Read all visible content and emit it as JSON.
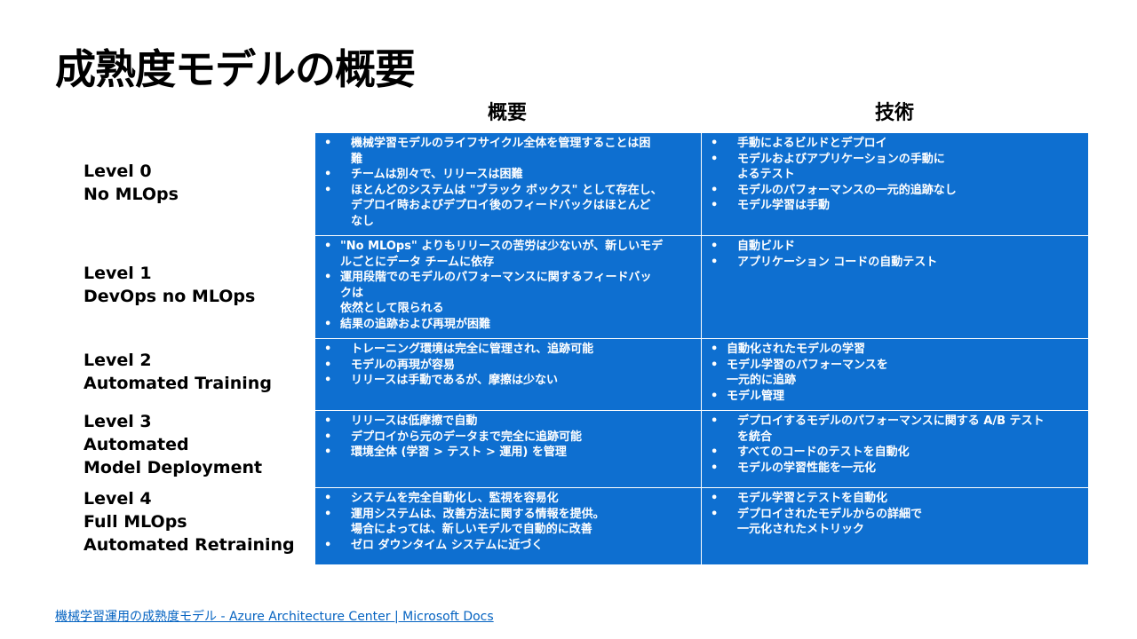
{
  "title": "成熟度モデルの概要",
  "columns": {
    "overview": "概要",
    "technology": "技術"
  },
  "rows": [
    {
      "level": [
        "Level 0",
        "No MLOps"
      ],
      "overview": [
        [
          "機械学習モデルのライフサイクル全体を管理することは困",
          "難"
        ],
        [
          "チームは別々で、リリースは困難"
        ],
        [
          "ほとんどのシステムは \"ブラック ボックス\" として存在し、",
          "デプロイ時およびデプロイ後のフィードバックはほとんど",
          "なし"
        ]
      ],
      "technology": [
        [
          "手動によるビルドとデプロイ"
        ],
        [
          "モデルおよびアプリケーションの手動に",
          "よるテスト"
        ],
        [
          "モデルのパフォーマンスの一元的追跡なし"
        ],
        [
          "モデル学習は手動"
        ]
      ]
    },
    {
      "level": [
        "Level 1",
        "DevOps no MLOps"
      ],
      "overview": [
        [
          "\"No MLOps\" よりもリリースの苦労は少ないが、新しいモデ",
          "ルごとにデータ チームに依存"
        ],
        [
          "運用段階でのモデルのパフォーマンスに関するフィードバッ",
          "クは",
          "依然として限られる"
        ],
        [
          "結果の追跡および再現が困難"
        ]
      ],
      "technology": [
        [
          "自動ビルド"
        ],
        [
          "アプリケーション コードの自動テスト"
        ]
      ]
    },
    {
      "level": [
        "Level 2",
        "Automated Training"
      ],
      "overview": [
        [
          "トレーニング環境は完全に管理され、追跡可能"
        ],
        [
          "モデルの再現が容易"
        ],
        [
          "リリースは手動であるが、摩擦は少ない"
        ]
      ],
      "technology": [
        [
          "自動化されたモデルの学習"
        ],
        [
          "モデル学習のパフォーマンスを",
          "一元的に追跡"
        ],
        [
          "モデル管理"
        ]
      ]
    },
    {
      "level": [
        "Level 3",
        "Automated",
        "Model Deployment"
      ],
      "overview": [
        [
          "リリースは低摩擦で自動"
        ],
        [
          "デプロイから元のデータまで完全に追跡可能"
        ],
        [
          "環境全体 (学習 > テスト > 運用) を管理"
        ]
      ],
      "technology": [
        [
          "デプロイするモデルのパフォーマンスに関する A/B テスト",
          "を統合"
        ],
        [
          "すべてのコードのテストを自動化"
        ],
        [
          "モデルの学習性能を一元化"
        ]
      ]
    },
    {
      "level": [
        "Level 4",
        "Full MLOps",
        "Automated Retraining"
      ],
      "overview": [
        [
          "システムを完全自動化し、監視を容易化"
        ],
        [
          "運用システムは、改善方法に関する情報を提供。",
          "場合によっては、新しいモデルで自動的に改善"
        ],
        [
          "ゼロ ダウンタイム システムに近づく"
        ]
      ],
      "technology": [
        [
          "モデル学習とテストを自動化"
        ],
        [
          "デプロイされたモデルからの詳細で",
          "一元化されたメトリック"
        ]
      ]
    }
  ],
  "link_text": "機械学習運用の成熟度モデル - Azure Architecture Center | Microsoft Docs",
  "bullet": "•",
  "colors": {
    "cell_bg": "#0e6fd0",
    "link": "#0563c1"
  }
}
